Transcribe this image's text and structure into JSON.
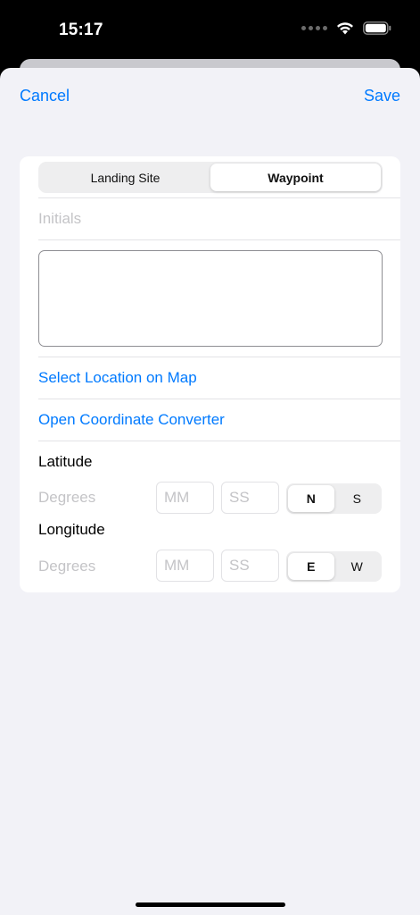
{
  "status_bar": {
    "time": "15:17"
  },
  "nav": {
    "cancel_label": "Cancel",
    "save_label": "Save"
  },
  "form": {
    "type_segments": [
      {
        "label": "Landing Site",
        "selected": false
      },
      {
        "label": "Waypoint",
        "selected": true
      }
    ],
    "initials_placeholder": "Initials",
    "notes_value": "",
    "select_location_label": "Select Location on Map",
    "converter_label": "Open Coordinate Converter",
    "latitude": {
      "label": "Latitude",
      "degrees_placeholder": "Degrees",
      "minutes_placeholder": "MM",
      "seconds_placeholder": "SS",
      "hemispheres": [
        "N",
        "S"
      ],
      "selected_hemisphere": "N"
    },
    "longitude": {
      "label": "Longitude",
      "degrees_placeholder": "Degrees",
      "minutes_placeholder": "MM",
      "seconds_placeholder": "SS",
      "hemispheres": [
        "E",
        "W"
      ],
      "selected_hemisphere": "E"
    }
  },
  "colors": {
    "accent": "#007aff",
    "background": "#f2f2f7",
    "card": "#ffffff"
  }
}
